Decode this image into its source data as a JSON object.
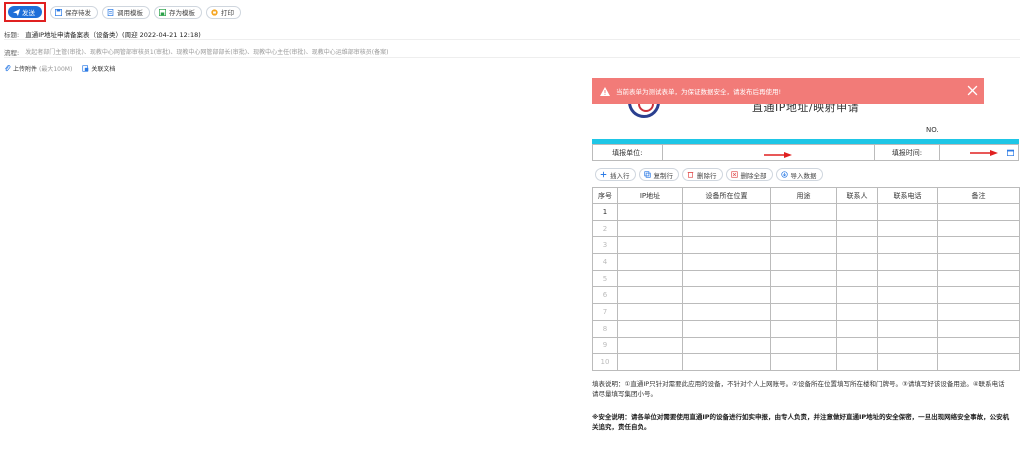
{
  "toolbar": {
    "send": "发送",
    "save_draft": "保存待发",
    "use_template": "调用模板",
    "save_template": "存为模板",
    "print": "打印"
  },
  "header": {
    "title_label": "标题:",
    "title_value": "直通IP地址申请备案表（设备类）(周迎 2022-04-21 12:18)",
    "flow_label": "流程:",
    "flow_value": "发起者部门主管(审批)、现教中心网管部审核员1(审批)、现教中心网管部部长(审批)、现教中心主任(审批)、现教中心运维部审核员(备案)"
  },
  "attachments": {
    "upload_label": "上传附件",
    "upload_hint": "(最大100M)",
    "related_docs": "关联文档"
  },
  "alert": {
    "message": "当前表单为测试表单，为保证数据安全，请发布后再使用!"
  },
  "form": {
    "title": "直通IP地址/映射申请",
    "no_label": "NO.",
    "unit_label": "填报单位:",
    "time_label": "填报时间:"
  },
  "row_actions": {
    "insert": "插入行",
    "copy": "复制行",
    "delete": "删除行",
    "delete_all": "删除全部",
    "import": "导入数据"
  },
  "table": {
    "headers": [
      "序号",
      "IP地址",
      "设备所在位置",
      "用途",
      "联系人",
      "联系电话",
      "备注"
    ],
    "row_numbers": [
      "1",
      "2",
      "3",
      "4",
      "5",
      "6",
      "7",
      "8",
      "9",
      "10"
    ]
  },
  "notes": {
    "fill_instructions": "填表说明：①直通IP只针对需要此应用的设备，不针对个人上网账号。②设备所在位置填写所在楼和门牌号。③请填写好该设备用途。④联系电话请尽量填写集团小号。",
    "security_note": "※安全说明：请各单位对需要使用直通IP的设备进行如实申报，由专人负责，并注意做好直通IP地址的安全保密，一旦出现网络安全事故，公安机关追究，责任自负。"
  },
  "colors": {
    "send_blue": "#1e6fd9",
    "highlight_red": "#e02020",
    "alert_bg": "#f27b78",
    "cyan_bar": "#1ec6e6"
  }
}
